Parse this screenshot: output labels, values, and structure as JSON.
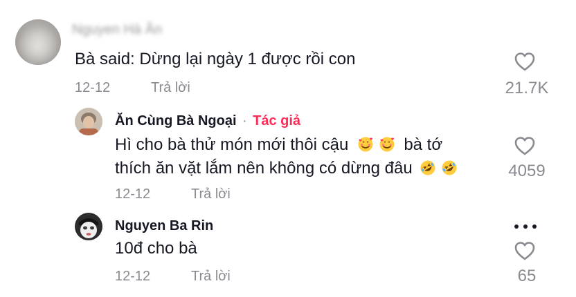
{
  "comments": [
    {
      "name": "Nguyen Hà Ân",
      "text": "Bà said: Dừng lại ngày 1 được rồi con",
      "date": "12-12",
      "reply_label": "Trả lời",
      "likes": "21.7K"
    },
    {
      "name": "Ăn Cùng Bà Ngoại",
      "separator": "·",
      "author_tag": "Tác giả",
      "text_line1_a": "Hì cho bà thử món mới thôi cậu",
      "text_line1_b": "bà tớ",
      "text_line2": "thích ăn vặt lắm nên không có dừng đâu",
      "date": "12-12",
      "reply_label": "Trả lời",
      "likes": "4059"
    },
    {
      "name": "Nguyen Ba Rin",
      "text": "10đ cho bà",
      "date": "12-12",
      "reply_label": "Trả lời",
      "likes": "65"
    }
  ],
  "icons": {
    "like": "heart-outline-icon",
    "more": "more-dots-icon",
    "smile_hearts": "smiling-face-with-hearts-emoji",
    "rofl": "rolling-on-floor-laughing-emoji"
  },
  "colors": {
    "text": "#161823",
    "muted": "#8a8b91",
    "author_tag": "#fe2c55"
  }
}
